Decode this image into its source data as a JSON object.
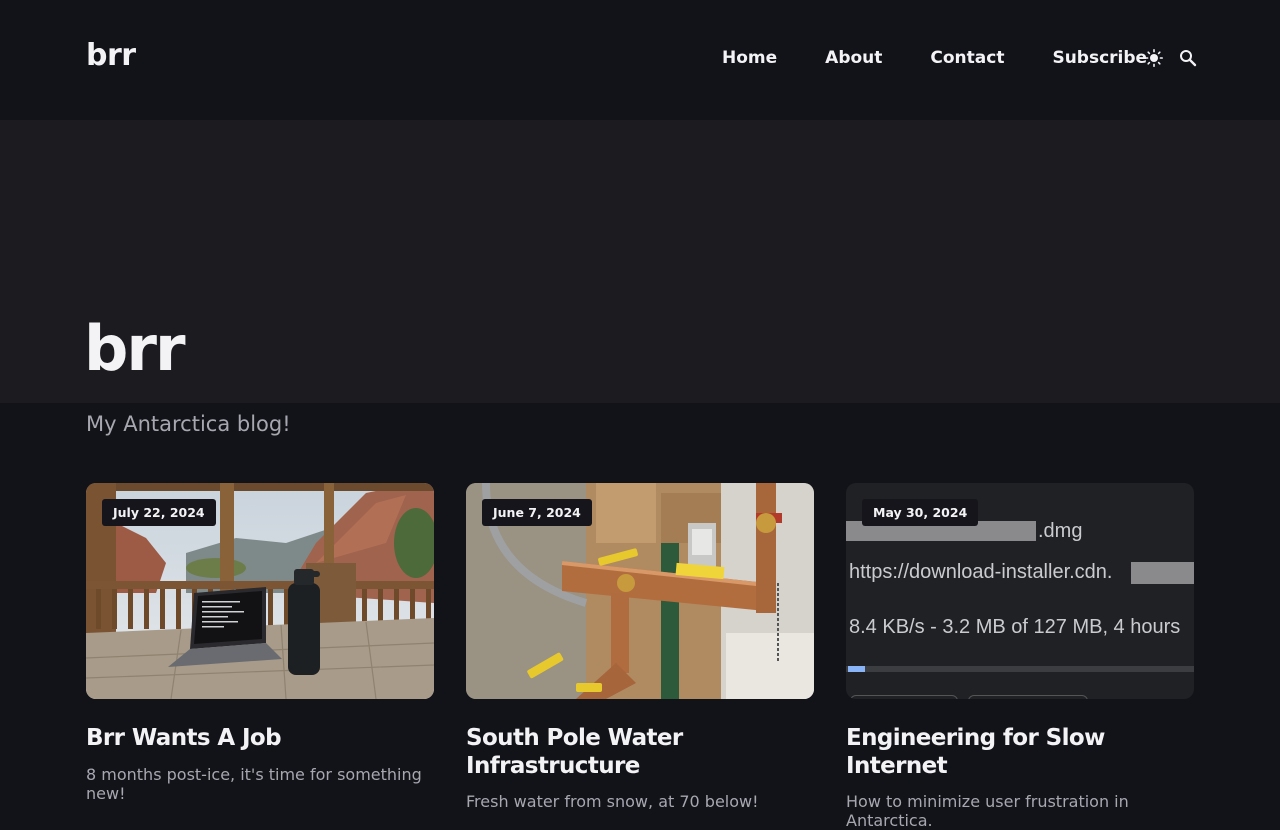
{
  "site": {
    "logo": "brr"
  },
  "nav": {
    "items": [
      {
        "label": "Home"
      },
      {
        "label": "About"
      },
      {
        "label": "Contact"
      },
      {
        "label": "Subscribe"
      }
    ],
    "icons": [
      "sun-icon",
      "search-icon"
    ]
  },
  "hero": {
    "title": "brr",
    "subtitle": "My Antarctica blog!"
  },
  "posts": [
    {
      "date": "July 22, 2024",
      "title": "Brr Wants A Job",
      "excerpt": "8 months post-ice, it's time for something new!"
    },
    {
      "date": "June 7, 2024",
      "title": "South Pole Water Infrastructure",
      "excerpt": "Fresh water from snow, at 70 below!"
    },
    {
      "date": "May 30, 2024",
      "title": "Engineering for Slow Internet",
      "excerpt": "How to minimize user frustration in Antarctica.",
      "image_text": {
        "filename": ".dmg",
        "url": "https://download-installer.cdn.",
        "progress": "8.4 KB/s - 3.2 MB of 127 MB, 4 hours",
        "progress_fraction": 0.025
      }
    }
  ],
  "colors": {
    "background": "#121219",
    "hero_background": "#1b1b20",
    "text": "#f3f3f5",
    "muted": "#a7a7b0"
  }
}
